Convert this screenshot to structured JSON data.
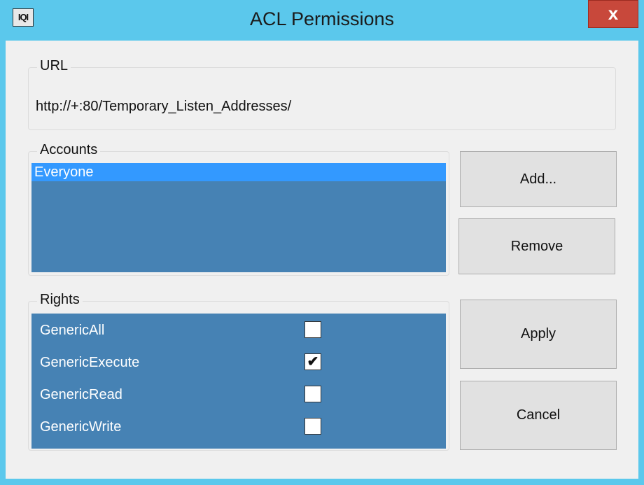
{
  "window": {
    "title": "ACL Permissions",
    "close_label": "x",
    "icon_label": "IQI"
  },
  "url_group": {
    "legend": "URL",
    "value": "http://+:80/Temporary_Listen_Addresses/"
  },
  "accounts_group": {
    "legend": "Accounts",
    "items": [
      "Everyone"
    ],
    "selected_index": 0
  },
  "rights_group": {
    "legend": "Rights",
    "rights": [
      {
        "label": "GenericAll",
        "checked": false
      },
      {
        "label": "GenericExecute",
        "checked": true
      },
      {
        "label": "GenericRead",
        "checked": false
      },
      {
        "label": "GenericWrite",
        "checked": false
      }
    ]
  },
  "buttons": {
    "add": "Add...",
    "remove": "Remove",
    "apply": "Apply",
    "cancel": "Cancel"
  },
  "colors": {
    "title_bar": "#5bc8ec",
    "close": "#c8483b",
    "list_bg": "#4682b4",
    "selection": "#3399ff"
  }
}
